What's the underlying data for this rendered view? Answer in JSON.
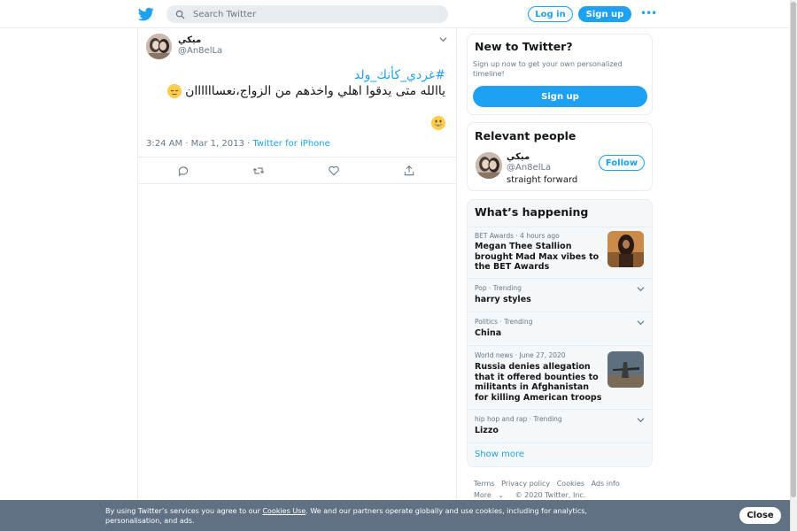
{
  "header": {
    "search_placeholder": "Search Twitter",
    "login_label": "Log in",
    "signup_label": "Sign up",
    "more_label": "•••"
  },
  "tweet": {
    "display_name": "ميكي",
    "handle": "@An8elLa",
    "hashtag": "#غردي_كأنك_ولد",
    "text": "ياالله متى يدقوا اهلي واخذهم من الزواج،نعساااااان",
    "timestamp": "3:24 AM · Mar 1, 2013",
    "source": "Twitter for iPhone"
  },
  "sidebar": {
    "new_title": "New to Twitter?",
    "new_desc": "Sign up now to get your own personalized timeline!",
    "new_signup_label": "Sign up",
    "relevant_title": "Relevant people",
    "relevant_name": "ميكي",
    "relevant_handle": "@An8elLa",
    "relevant_bio": "straight forward",
    "follow_label": "Follow",
    "happening_title": "What’s happening",
    "trends": [
      {
        "meta": "BET Awards · 4 hours ago",
        "name": "Megan Thee Stallion brought Mad Max vibes to the BET Awards"
      },
      {
        "meta": "Pop · Trending",
        "name": "harry styles"
      },
      {
        "meta": "Politics · Trending",
        "name": "China"
      },
      {
        "meta": "World news · June 27, 2020",
        "name": "Russia denies allegation that it offered bounties to militants in Afghanistan for killing American troops"
      },
      {
        "meta": "hip hop and rap · Trending",
        "name": "Lizzo"
      }
    ],
    "show_more_label": "Show more",
    "footer_links": [
      "Terms",
      "Privacy policy",
      "Cookies",
      "Ads info"
    ],
    "footer_more": "More",
    "footer_copyright": "© 2020 Twitter, Inc."
  },
  "cookie": {
    "text_before": "By using Twitter’s services you agree to our ",
    "link": "Cookies Use",
    "text_after": ". We and our partners operate globally and use cookies, including for analytics, personalisation, and ads.",
    "close_label": "Close"
  },
  "colors": {
    "accent": "#1da1f2",
    "cookie_bar": "#5f7183"
  }
}
